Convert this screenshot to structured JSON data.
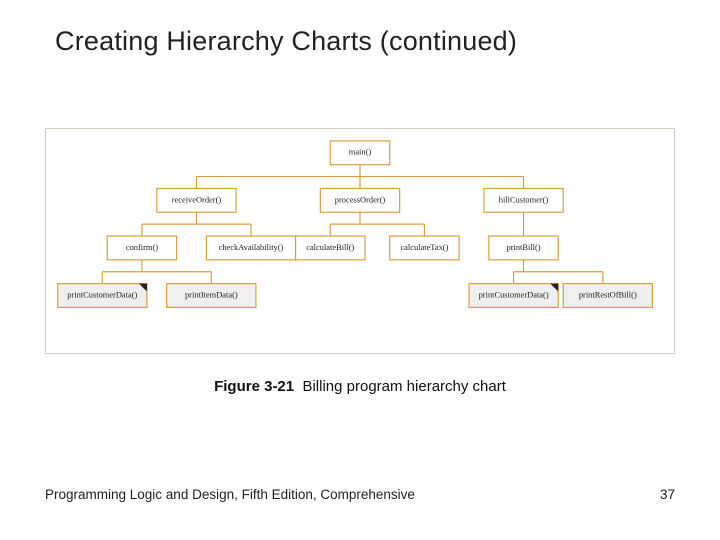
{
  "title": "Creating Hierarchy Charts (continued)",
  "caption": {
    "figno": "Figure 3-21",
    "text": "Billing program hierarchy chart"
  },
  "footer": {
    "left": "Programming Logic and Design, Fifth Edition, Comprehensive",
    "right": "37"
  },
  "chart_data": {
    "type": "tree",
    "root": "main()",
    "nodes": {
      "main()": {
        "children": [
          "receiveOrder()",
          "processOrder()",
          "billCustomer()"
        ]
      },
      "receiveOrder()": {
        "children": [
          "confirm()",
          "checkAvailability()"
        ]
      },
      "processOrder()": {
        "children": [
          "calculateBill()",
          "calculateTax()"
        ]
      },
      "billCustomer()": {
        "children": [
          "printBill()"
        ]
      },
      "confirm()": {
        "children": [
          "printCustomerData()",
          "printItemData()"
        ]
      },
      "checkAvailability()": {},
      "calculateBill()": {},
      "calculateTax()": {},
      "printBill()": {
        "children": [
          "printCustomerData()#2",
          "printRestOfBill()"
        ]
      },
      "printCustomerData()": {
        "shaded": true,
        "cornerMark": true
      },
      "printItemData()": {
        "shaded": true
      },
      "printCustomerData()#2": {
        "label": "printCustomerData()",
        "shaded": true,
        "cornerMark": true
      },
      "printRestOfBill()": {
        "shaded": true
      }
    }
  },
  "labels": {
    "main": "main()",
    "receiveOrder": "receiveOrder()",
    "processOrder": "processOrder()",
    "billCustomer": "billCustomer()",
    "confirm": "confirm()",
    "checkAvailability": "checkAvailability()",
    "calculateBill": "calculateBill()",
    "calculateTax": "calculateTax()",
    "printBill": "printBill()",
    "printCustomerData": "printCustomerData()",
    "printItemData": "printItemData()",
    "printRestOfBill": "printRestOfBill()"
  }
}
